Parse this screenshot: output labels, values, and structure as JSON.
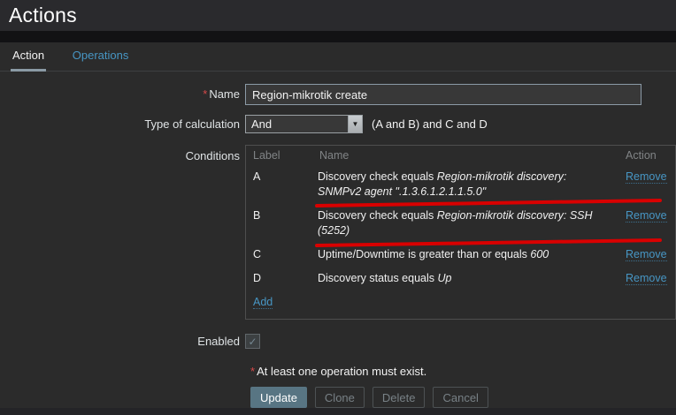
{
  "page": {
    "title": "Actions"
  },
  "tabs": [
    {
      "label": "Action"
    },
    {
      "label": "Operations"
    }
  ],
  "form": {
    "required_mark": "*",
    "name_label": "Name",
    "name_value": "Region-mikrotik create",
    "calc_label": "Type of calculation",
    "calc_value": "And",
    "calc_formula": "(A and B) and C and D",
    "conditions_label": "Conditions",
    "enabled_label": "Enabled",
    "note": "At least one operation must exist."
  },
  "conditions": {
    "headers": {
      "label": "Label",
      "name": "Name",
      "action": "Action"
    },
    "rows": [
      {
        "label": "A",
        "text": "Discovery check equals ",
        "value": "Region-mikrotik discovery: SNMPv2 agent \".1.3.6.1.2.1.1.5.0\"",
        "action": "Remove"
      },
      {
        "label": "B",
        "text": "Discovery check equals ",
        "value": "Region-mikrotik discovery: SSH (5252)",
        "action": "Remove"
      },
      {
        "label": "C",
        "text": "Uptime/Downtime is greater than or equals ",
        "value": "600",
        "action": "Remove"
      },
      {
        "label": "D",
        "text": "Discovery status equals ",
        "value": "Up",
        "action": "Remove"
      }
    ],
    "add_label": "Add"
  },
  "buttons": {
    "update": "Update",
    "clone": "Clone",
    "delete": "Delete",
    "cancel": "Cancel"
  },
  "icons": {
    "dropdown_arrow": "▼",
    "checkmark": "✓"
  },
  "colors": {
    "link_blue": "#4796c4",
    "annotation_red": "#d90000",
    "update_button_bg": "#587583",
    "background": "#2b2b2b"
  }
}
